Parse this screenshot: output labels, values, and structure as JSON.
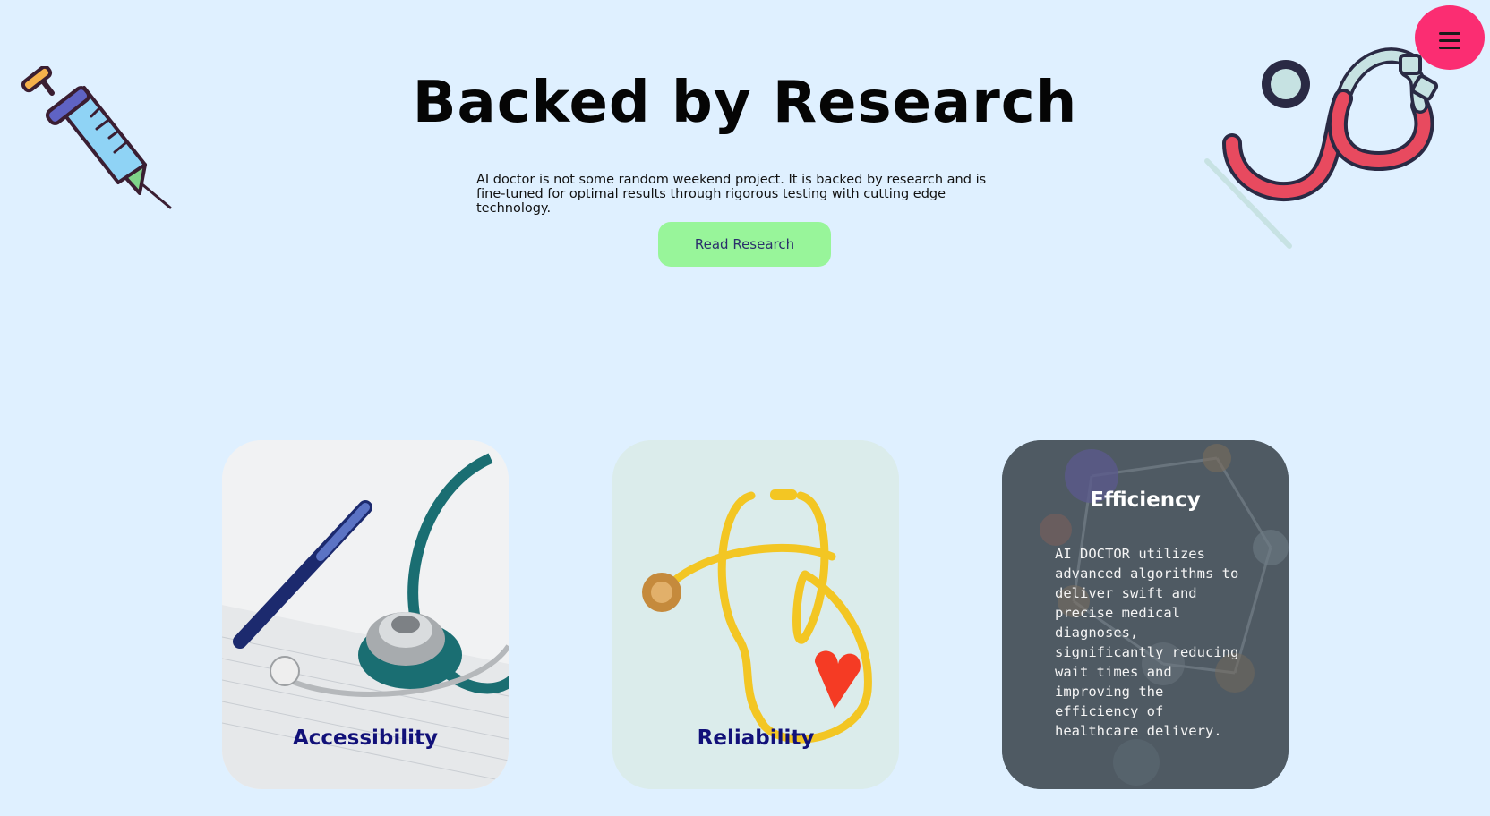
{
  "hero": {
    "title": "Backed by Research",
    "description": "AI doctor is not some random weekend project. It is backed by research and is fine-tuned for optimal results through rigorous testing with cutting edge technology.",
    "button_label": "Read Research"
  },
  "menu": {
    "icon": "hamburger-menu-icon"
  },
  "decorations": {
    "left_icon": "syringe-icon",
    "right_icon": "stethoscope-icon"
  },
  "cards": [
    {
      "title": "Accessibility",
      "image": "stethoscope-pen-paperwork-photo"
    },
    {
      "title": "Reliability",
      "image": "yellow-stethoscope-heart-photo"
    },
    {
      "title": "Efficiency",
      "image": "molecular-model-photo",
      "text": "AI DOCTOR utilizes advanced algorithms to deliver swift and precise medical diagnoses, significantly reducing wait times and improving the efficiency of healthcare delivery."
    }
  ],
  "colors": {
    "page_background": "#dff0ff",
    "button_green": "#98f59a",
    "menu_pink": "#fb2d72",
    "card_title_navy": "#121179"
  }
}
